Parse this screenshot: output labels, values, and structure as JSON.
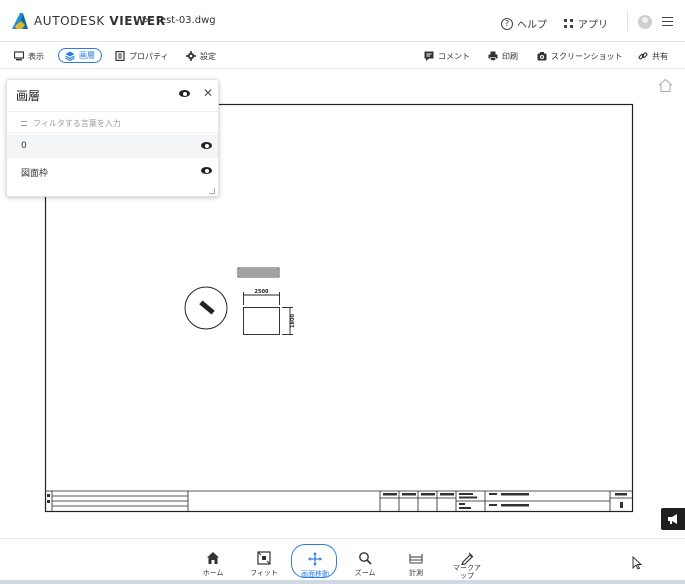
{
  "header": {
    "brand_regular": "AUTODESK",
    "brand_bold": "VIEWER",
    "crumb_sep": ">",
    "filename": "test-03.dwg",
    "help_label": "ヘルプ",
    "apps_label": "アプリ"
  },
  "toolbar": {
    "items": [
      {
        "label": "表示"
      },
      {
        "label": "画層"
      },
      {
        "label": "プロパティ"
      },
      {
        "label": "設定"
      }
    ],
    "right_items": [
      {
        "label": "コメント"
      },
      {
        "label": "印刷"
      },
      {
        "label": "スクリーンショット"
      },
      {
        "label": "共有"
      }
    ]
  },
  "layer_panel": {
    "title": "画層",
    "filter_placeholder": "フィルタする言葉を入力",
    "rows": [
      {
        "name": "0",
        "selected": true
      },
      {
        "name": "図面枠",
        "selected": false
      }
    ]
  },
  "drawing": {
    "dim_width": "2500",
    "dim_height": "1800"
  },
  "bottom_nav": {
    "items": [
      {
        "label": "ホーム"
      },
      {
        "label": "フィット"
      },
      {
        "label": "画面移動"
      },
      {
        "label": "ズーム"
      },
      {
        "label": "計測"
      },
      {
        "label": "マークア\nップ"
      }
    ]
  },
  "colors": {
    "accent": "#2c7be5",
    "logo_blue": "#1d91d0",
    "logo_yellow": "#ffc21a"
  }
}
